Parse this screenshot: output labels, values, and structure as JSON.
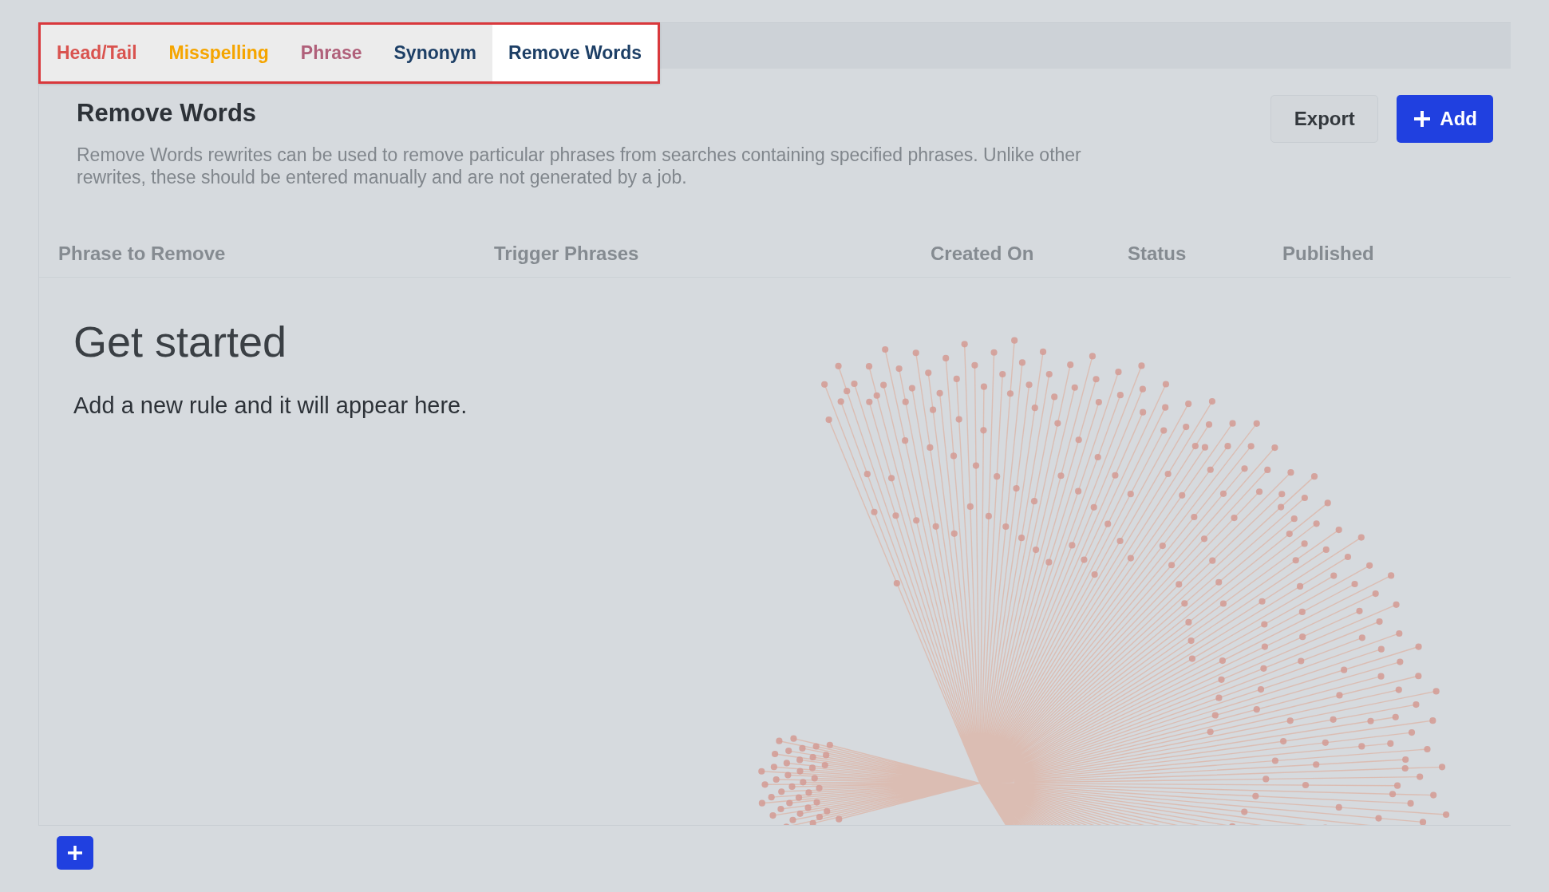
{
  "tabs": [
    {
      "label": "Head/Tail",
      "color": "#d9534f",
      "selected": false
    },
    {
      "label": "Misspelling",
      "color": "#f5a500",
      "selected": false
    },
    {
      "label": "Phrase",
      "color": "#b0607a",
      "selected": false
    },
    {
      "label": "Synonym",
      "color": "#1d3f66",
      "selected": false
    },
    {
      "label": "Remove Words",
      "color": "#1d3f66",
      "selected": true
    }
  ],
  "page": {
    "title": "Remove Words",
    "description": "Remove Words rewrites can be used to remove particular phrases from searches containing specified phrases. Unlike other rewrites, these should be entered manually and are not generated by a job.",
    "buttons": [
      {
        "kind": "secondary",
        "label": "Export"
      },
      {
        "kind": "primary",
        "label": "Add"
      }
    ]
  },
  "table": {
    "columns": [
      "Phrase to Remove",
      "Trigger Phrases",
      "Created On",
      "Status",
      "Published"
    ]
  },
  "empty_state": {
    "title": "Get started",
    "message": "Add a new rule and it will appear here."
  }
}
